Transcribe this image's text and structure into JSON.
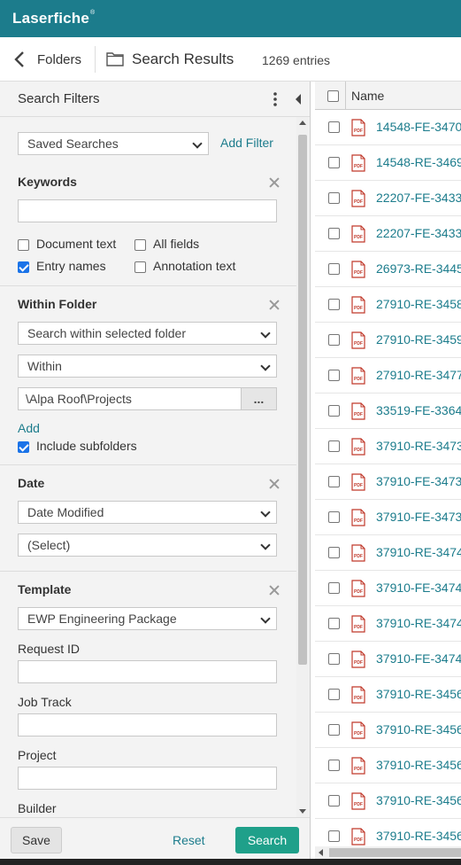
{
  "app": {
    "name": "Laserfiche",
    "mark": "®"
  },
  "nav": {
    "back_label": "Folders",
    "title": "Search Results",
    "count": "1269 entries"
  },
  "filters": {
    "title": "Search Filters",
    "saved_searches": "Saved Searches",
    "add_filter": "Add Filter",
    "keywords": {
      "title": "Keywords",
      "value": "",
      "options": [
        {
          "label": "Document text",
          "checked": false
        },
        {
          "label": "All fields",
          "checked": false
        },
        {
          "label": "Entry names",
          "checked": true
        },
        {
          "label": "Annotation text",
          "checked": false
        }
      ]
    },
    "within_folder": {
      "title": "Within Folder",
      "scope": "Search within selected folder",
      "mode": "Within",
      "path": "\\Alpa Roof\\Projects",
      "browse": "...",
      "add": "Add",
      "include_subfolders": "Include subfolders",
      "include_subfolders_checked": true
    },
    "date": {
      "title": "Date",
      "field": "Date Modified",
      "range": "(Select)"
    },
    "template": {
      "title": "Template",
      "value": "EWP Engineering Package",
      "fields": [
        {
          "label": "Request ID",
          "value": ""
        },
        {
          "label": "Job Track",
          "value": ""
        },
        {
          "label": "Project",
          "value": ""
        },
        {
          "label": "Builder",
          "value": ""
        }
      ]
    },
    "buttons": {
      "save": "Save",
      "reset": "Reset",
      "search": "Search"
    }
  },
  "results": {
    "column_name": "Name",
    "icon": "pdf-icon",
    "rows": [
      "14548-FE-3470",
      "14548-RE-3469",
      "22207-FE-3433",
      "22207-FE-3433",
      "26973-RE-3445",
      "27910-RE-3458",
      "27910-RE-3459",
      "27910-RE-3477",
      "33519-FE-3364",
      "37910-RE-3473",
      "37910-FE-3473",
      "37910-FE-3473",
      "37910-RE-3474",
      "37910-FE-3474",
      "37910-RE-3474",
      "37910-FE-3474",
      "37910-RE-3456",
      "37910-RE-3456",
      "37910-RE-3456",
      "37910-RE-3456",
      "37910-RE-3456"
    ]
  },
  "colors": {
    "brand": "#1c7c8c",
    "primary_button": "#1fa08a",
    "checkbox": "#1a73e8"
  }
}
